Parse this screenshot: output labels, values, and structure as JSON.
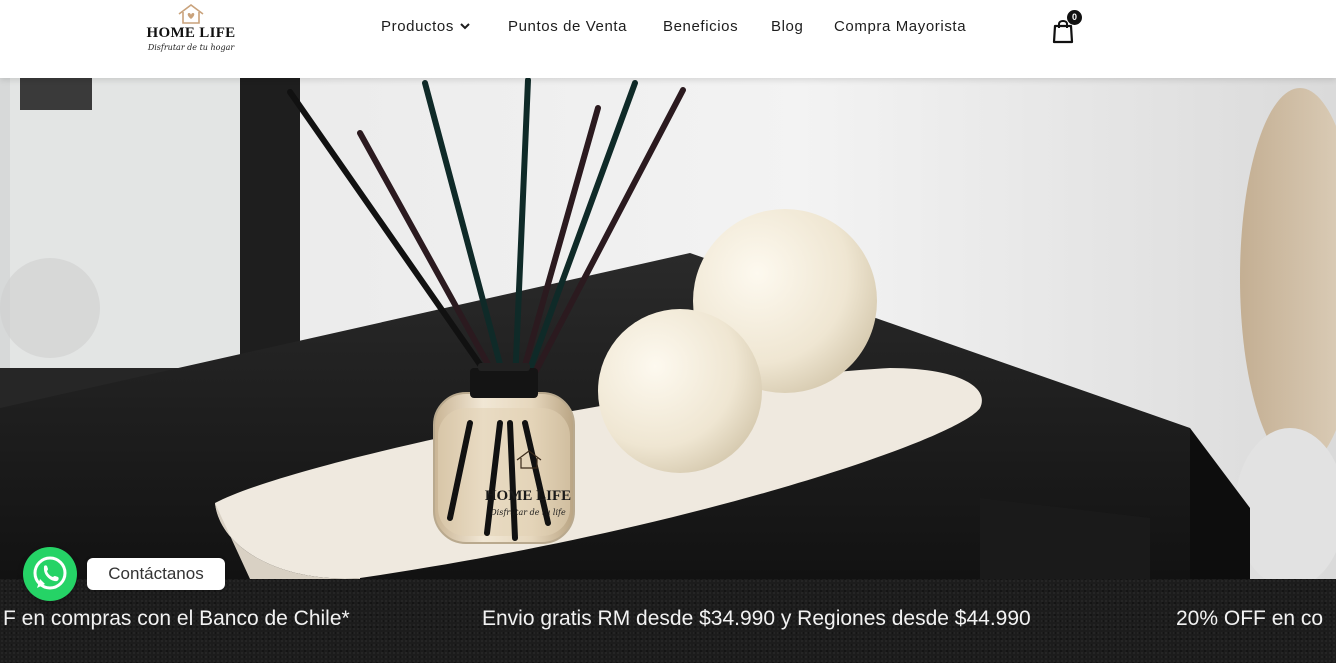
{
  "brand": {
    "name": "HOME LIFE",
    "tagline": "Disfrutar de tu hogar"
  },
  "nav": {
    "items": [
      {
        "label": "Productos",
        "has_dropdown": true
      },
      {
        "label": "Puntos de Venta"
      },
      {
        "label": "Beneficios"
      },
      {
        "label": "Blog"
      },
      {
        "label": "Compra Mayorista"
      }
    ]
  },
  "cart": {
    "count": "0",
    "icon": "shopping-bag-icon"
  },
  "hero": {
    "image": "reed-diffuser-with-candles",
    "product_label": "HOME LIFE",
    "product_tagline": "Disfrutar de tu life"
  },
  "whatsapp": {
    "label": "Contáctanos",
    "icon": "whatsapp-icon",
    "color": "#25d366"
  },
  "ticker": {
    "items": [
      "F en compras con el Banco de Chile*",
      "Envio gratis RM desde $34.990 y Regiones desde $44.990",
      "20% OFF en co"
    ]
  },
  "colors": {
    "ticker_bg": "#1c1c1c",
    "header_bg": "#ffffff",
    "brand_gold": "#c9a27b"
  }
}
